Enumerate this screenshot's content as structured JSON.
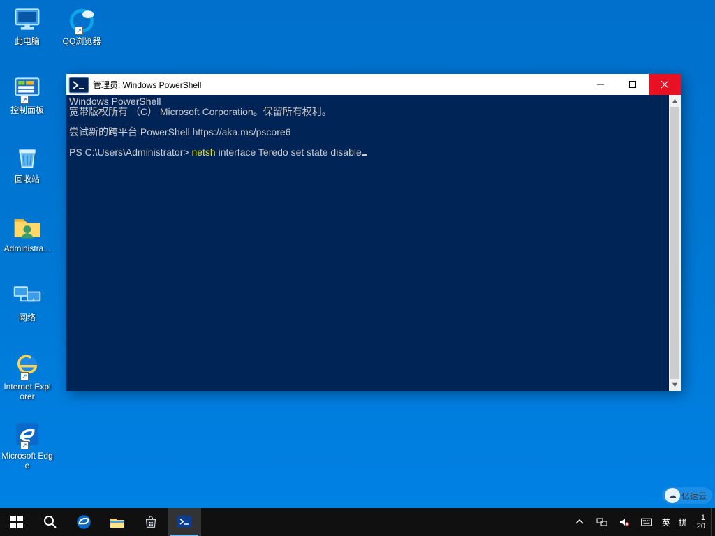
{
  "desktop": {
    "icons": [
      {
        "label": "此电脑"
      },
      {
        "label": "QQ浏览器"
      },
      {
        "label": "控制面板"
      },
      {
        "label": "回收站"
      },
      {
        "label": "Administra..."
      },
      {
        "label": "网络"
      },
      {
        "label": "Internet Explorer"
      },
      {
        "label": "Microsoft Edge"
      }
    ]
  },
  "window": {
    "title": "管理员: Windows PowerShell",
    "lines": {
      "l1": "Windows PowerShell",
      "l2": "宽带版权所有 （C） Microsoft Corporation。保留所有权利。",
      "l3": "尝试新的跨平台 PowerShell https://aka.ms/pscore6",
      "prompt": "PS C:\\Users\\Administrator> ",
      "cmd_yellow": "netsh",
      "cmd_rest": " interface Teredo set state disable"
    }
  },
  "taskbar": {
    "lang": "英",
    "ime_mode": "拼",
    "clock_top": "1",
    "clock_bottom": "20"
  },
  "watermark": {
    "text": "亿速云"
  }
}
